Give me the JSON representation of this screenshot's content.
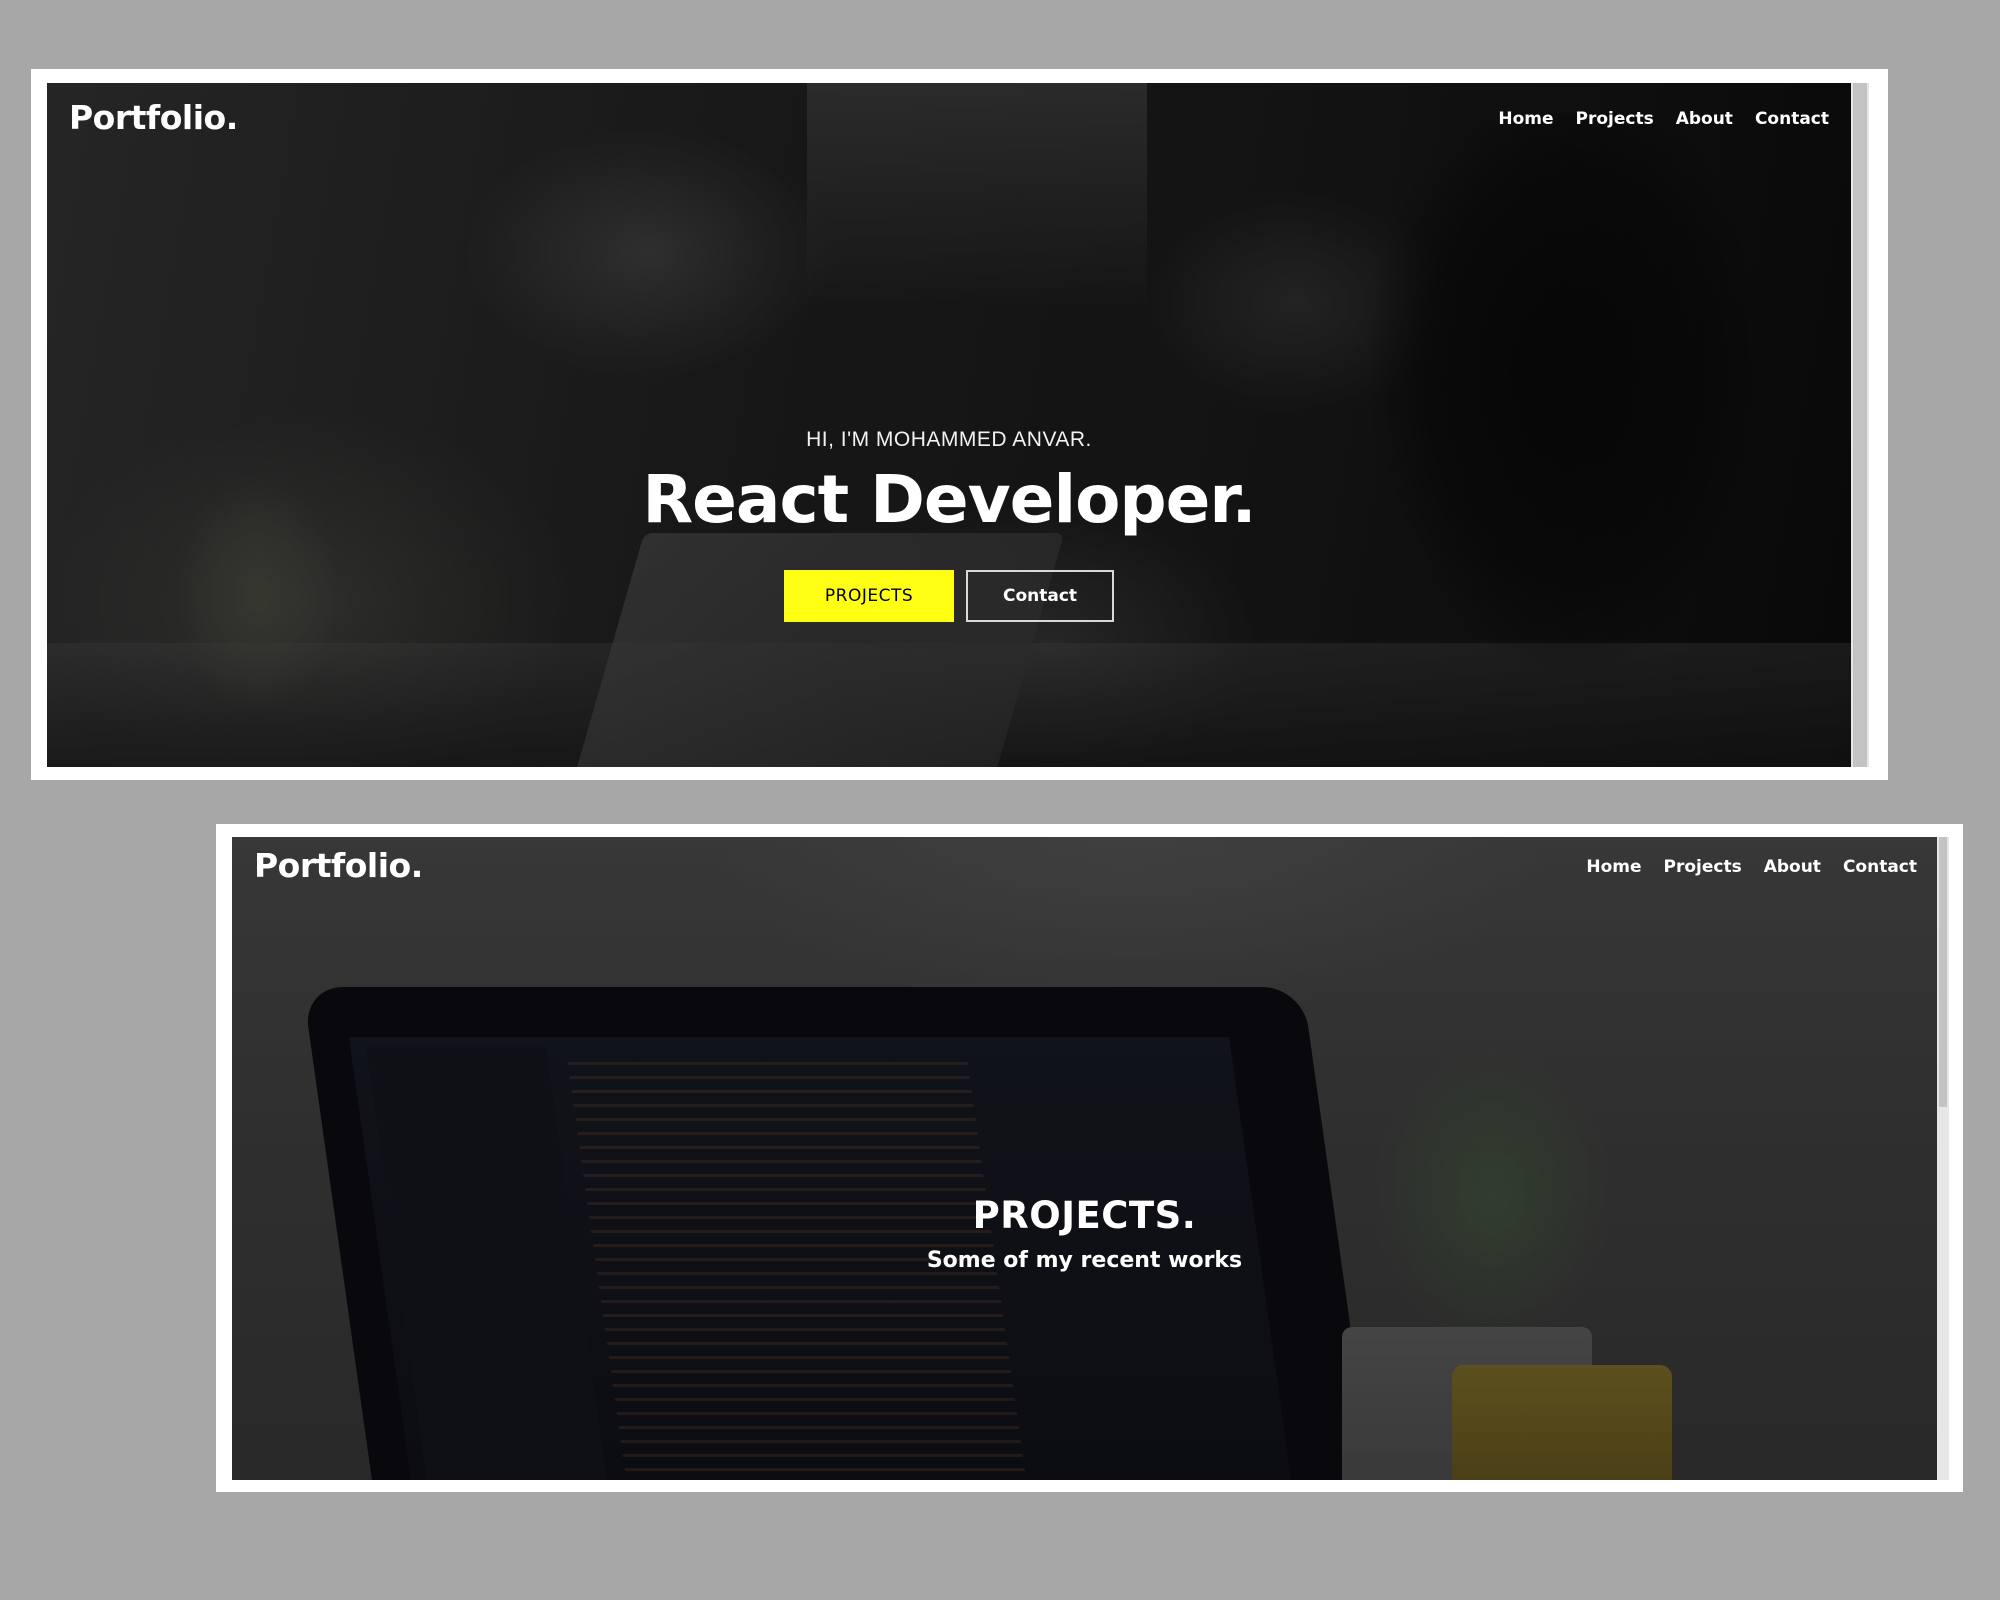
{
  "screens": [
    {
      "logo": "Portfolio.",
      "nav": [
        "Home",
        "Projects",
        "About",
        "Contact"
      ],
      "hero": {
        "intro": "HI, I'M MOHAMMED ANVAR.",
        "title": "React Developer.",
        "primary_button": "PROJECTS",
        "secondary_button": "Contact"
      }
    },
    {
      "logo": "Portfolio.",
      "nav": [
        "Home",
        "Projects",
        "About",
        "Contact"
      ],
      "section": {
        "title": "PROJECTS.",
        "subtitle": "Some of my recent works"
      }
    }
  ],
  "colors": {
    "page_background": "#a7a7a7",
    "accent_yellow": "#ffff14",
    "text": "#ffffff"
  }
}
